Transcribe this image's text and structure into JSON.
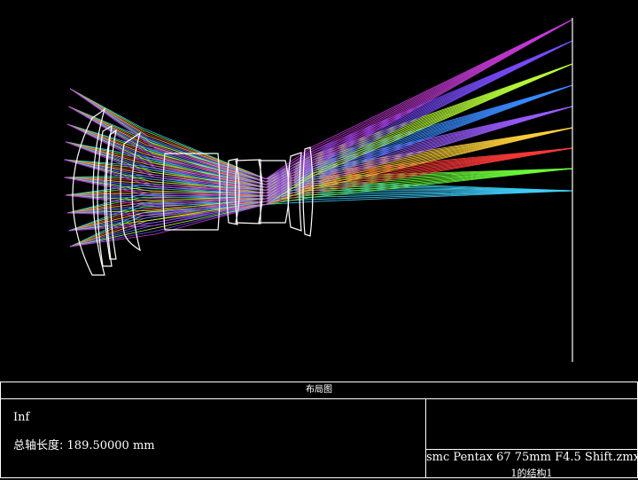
{
  "panel": {
    "title": "布局图",
    "field_line": "Inf",
    "total_length_label": "总轴长度:",
    "total_length_value": "189.50000 mm",
    "file_name": "smc Pentax 67 75mm F4.5 Shift.zmx",
    "config_label": "1的结构1"
  },
  "diagram": {
    "type": "optical-layout",
    "element_outline_color": "#ffffff",
    "image_plane_color": "#ffffff",
    "field_colors": [
      "#3fd2ff",
      "#6cff3a",
      "#ff3a3a",
      "#ffd23a",
      "#9a5cff",
      "#3a8cff",
      "#b9ff3a",
      "#7a4cff",
      "#c43ad6"
    ]
  }
}
